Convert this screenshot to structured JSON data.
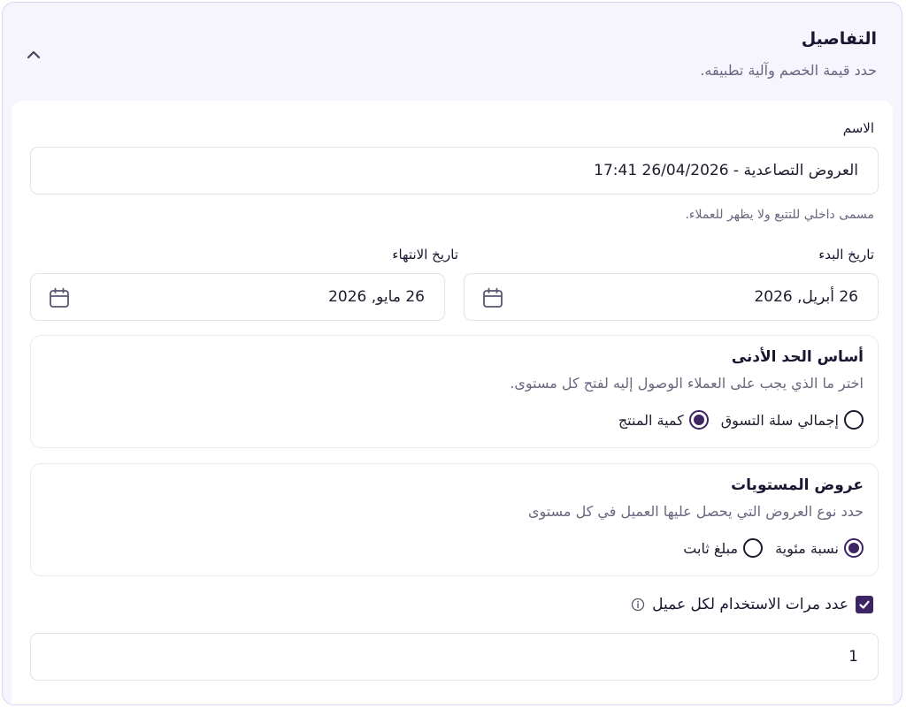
{
  "section": {
    "title": "التفاصيل",
    "subtitle": "حدد قيمة الخصم وآلية تطبيقه."
  },
  "name_field": {
    "label": "الاسم",
    "value": "العروض التصاعدية - 26/04/2026 17:41",
    "helper": "مسمى داخلي للتتبع ولا يظهر للعملاء."
  },
  "start_date": {
    "label": "تاريخ البدء",
    "value": "26 أبريل, 2026",
    "icon": "calendar-icon"
  },
  "end_date": {
    "label": "تاريخ الانتهاء",
    "value": "26 مايو, 2026",
    "icon": "calendar-icon"
  },
  "threshold_basis": {
    "title": "أساس الحد الأدنى",
    "description": "اختر ما الذي يجب على العملاء الوصول إليه لفتح كل مستوى.",
    "options": [
      {
        "label": "إجمالي سلة التسوق",
        "selected": false
      },
      {
        "label": "كمية المنتج",
        "selected": true
      }
    ]
  },
  "tier_offers": {
    "title": "عروض المستويات",
    "description": "حدد نوع العروض التي يحصل عليها العميل في كل مستوى",
    "options": [
      {
        "label": "نسبة مئوية",
        "selected": true
      },
      {
        "label": "مبلغ ثابت",
        "selected": false
      }
    ]
  },
  "usage_limit": {
    "label": "عدد مرات الاستخدام لكل عميل",
    "checked": true,
    "value": "1",
    "icon": "info-icon"
  },
  "colors": {
    "accent": "#3e2463",
    "panel_bg": "#f6f4fd",
    "panel_border": "#ddd3f5"
  }
}
